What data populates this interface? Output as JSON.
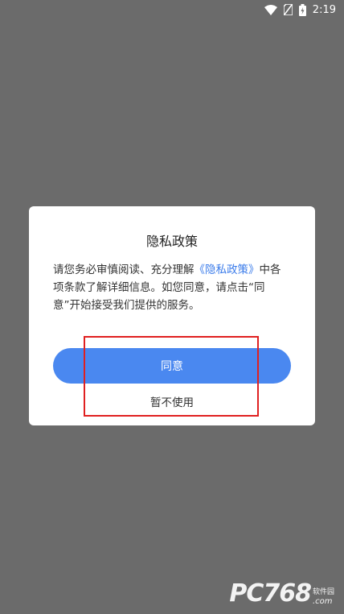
{
  "status_bar": {
    "time": "2:19",
    "icons": [
      "wifi-icon",
      "sim-icon",
      "battery-icon"
    ]
  },
  "dialog": {
    "title": "隐私政策",
    "body_before": "请您务必审慎阅读、充分理解",
    "policy_link": "《隐私政策》",
    "body_after": "中各项条款了解详细信息。如您同意，请点击“同意”开始接受我们提供的服务。",
    "agree_label": "同意",
    "decline_label": "暂不使用"
  },
  "watermark": {
    "main": "PC768",
    "cn": "软件园",
    "com": ".com"
  },
  "colors": {
    "backdrop": "#6b6b6b",
    "accent": "#4a88f0",
    "link": "#3a7bea",
    "highlight": "#e02020"
  }
}
